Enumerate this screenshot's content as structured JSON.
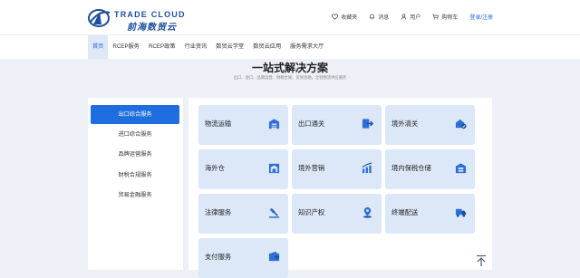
{
  "brand": {
    "name_en": "TRADE CLOUD",
    "name_cn": "前海数贸云"
  },
  "top_links": [
    {
      "icon": "heart-icon",
      "label": "收藏夹"
    },
    {
      "icon": "bell-icon",
      "label": "消息"
    },
    {
      "icon": "user-icon",
      "label": "用户"
    },
    {
      "icon": "cart-icon",
      "label": "购物车"
    },
    {
      "icon": "",
      "label": "登录/注册"
    }
  ],
  "nav": {
    "items": [
      "首页",
      "RCEP服务",
      "RCEP政策",
      "行业资讯",
      "数贸云学堂",
      "数贸云应用",
      "服务需求大厅"
    ],
    "active_index": 0
  },
  "hero": {
    "title": "一站式解决方案",
    "subtitle": "出口、进口、品牌运营、财税合规、贸易金融，全程物流供应服务"
  },
  "sidebar": {
    "items": [
      "出口综合服务",
      "进口综合服务",
      "品牌运营服务",
      "财税合规服务",
      "贸易金融服务"
    ],
    "active_index": 0
  },
  "services": [
    {
      "label": "物流运输",
      "icon": "warehouse-icon"
    },
    {
      "label": "出口通关",
      "icon": "export-icon"
    },
    {
      "label": "境外清关",
      "icon": "customs-clearance-icon"
    },
    {
      "label": "海外仓",
      "icon": "overseas-warehouse-icon"
    },
    {
      "label": "境外营销",
      "icon": "marketing-chart-icon"
    },
    {
      "label": "境内保税仓储",
      "icon": "bonded-warehouse-icon"
    },
    {
      "label": "法律服务",
      "icon": "gavel-icon"
    },
    {
      "label": "知识产权",
      "icon": "location-pin-icon"
    },
    {
      "label": "终端配送",
      "icon": "delivery-truck-icon"
    },
    {
      "label": "支付服务",
      "icon": "wallet-icon"
    }
  ],
  "colors": {
    "accent": "#1f6ee0",
    "card_bg": "#dce7f8",
    "page_bg": "#edf0f6"
  }
}
